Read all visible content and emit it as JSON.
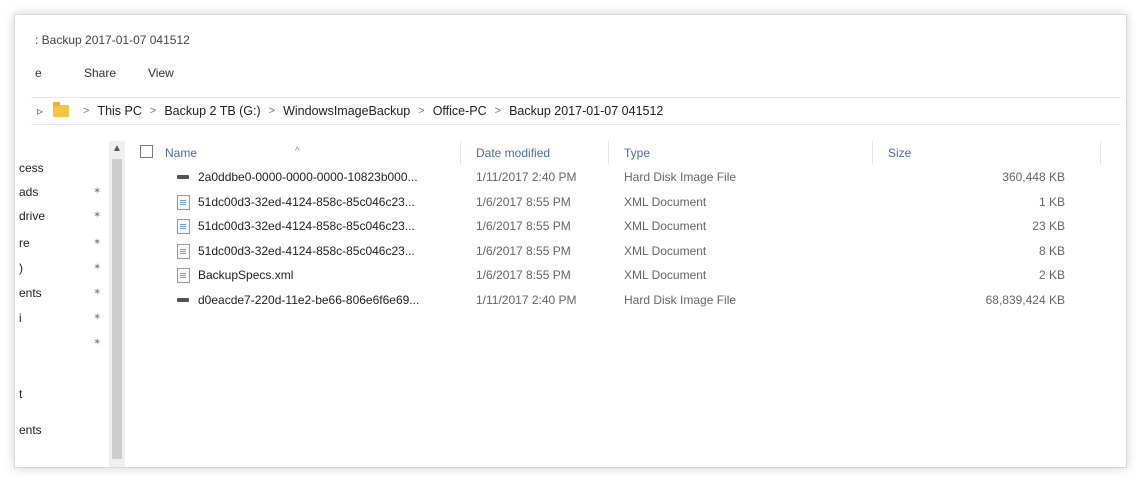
{
  "window": {
    "title": ": Backup 2017-01-07 041512"
  },
  "ribbon": {
    "tabs": [
      "e",
      "Share",
      "View"
    ]
  },
  "address_bar": {
    "back_glyph": "▹",
    "crumbs": [
      "This PC",
      "Backup 2 TB (G:)",
      "WindowsImageBackup",
      "Office-PC",
      "Backup 2017-01-07 041512"
    ],
    "separator": ">"
  },
  "nav_pane": {
    "items": [
      "cess",
      "ads",
      "drive",
      "re",
      ")",
      "ents",
      "i",
      "",
      "",
      "t",
      "ents"
    ],
    "pin_glyph": "✶"
  },
  "columns": {
    "name": "Name",
    "date_modified": "Date modified",
    "type": "Type",
    "size": "Size",
    "sort_glyph": "^"
  },
  "files": [
    {
      "icon": "hard-disk-icon",
      "name": "2a0ddbe0-0000-0000-0000-10823b000...",
      "date": "1/11/2017 2:40 PM",
      "type": "Hard Disk Image File",
      "size": "360,448 KB"
    },
    {
      "icon": "xml-file-icon",
      "name": "51dc00d3-32ed-4124-858c-85c046c23...",
      "date": "1/6/2017 8:55 PM",
      "type": "XML Document",
      "size": "1 KB"
    },
    {
      "icon": "xml-file-icon",
      "name": "51dc00d3-32ed-4124-858c-85c046c23...",
      "date": "1/6/2017 8:55 PM",
      "type": "XML Document",
      "size": "23 KB"
    },
    {
      "icon": "xml-file-icon",
      "name": "51dc00d3-32ed-4124-858c-85c046c23...",
      "date": "1/6/2017 8:55 PM",
      "type": "XML Document",
      "size": "8 KB"
    },
    {
      "icon": "xml-file-icon",
      "name": "BackupSpecs.xml",
      "date": "1/6/2017 8:55 PM",
      "type": "XML Document",
      "size": "2 KB"
    },
    {
      "icon": "hard-disk-icon",
      "name": "d0eacde7-220d-11e2-be66-806e6f6e69...",
      "date": "1/11/2017 2:40 PM",
      "type": "Hard Disk Image File",
      "size": "68,839,424 KB"
    }
  ],
  "colors": {
    "header_text": "#4d6d99",
    "folder": "#f5c542"
  }
}
